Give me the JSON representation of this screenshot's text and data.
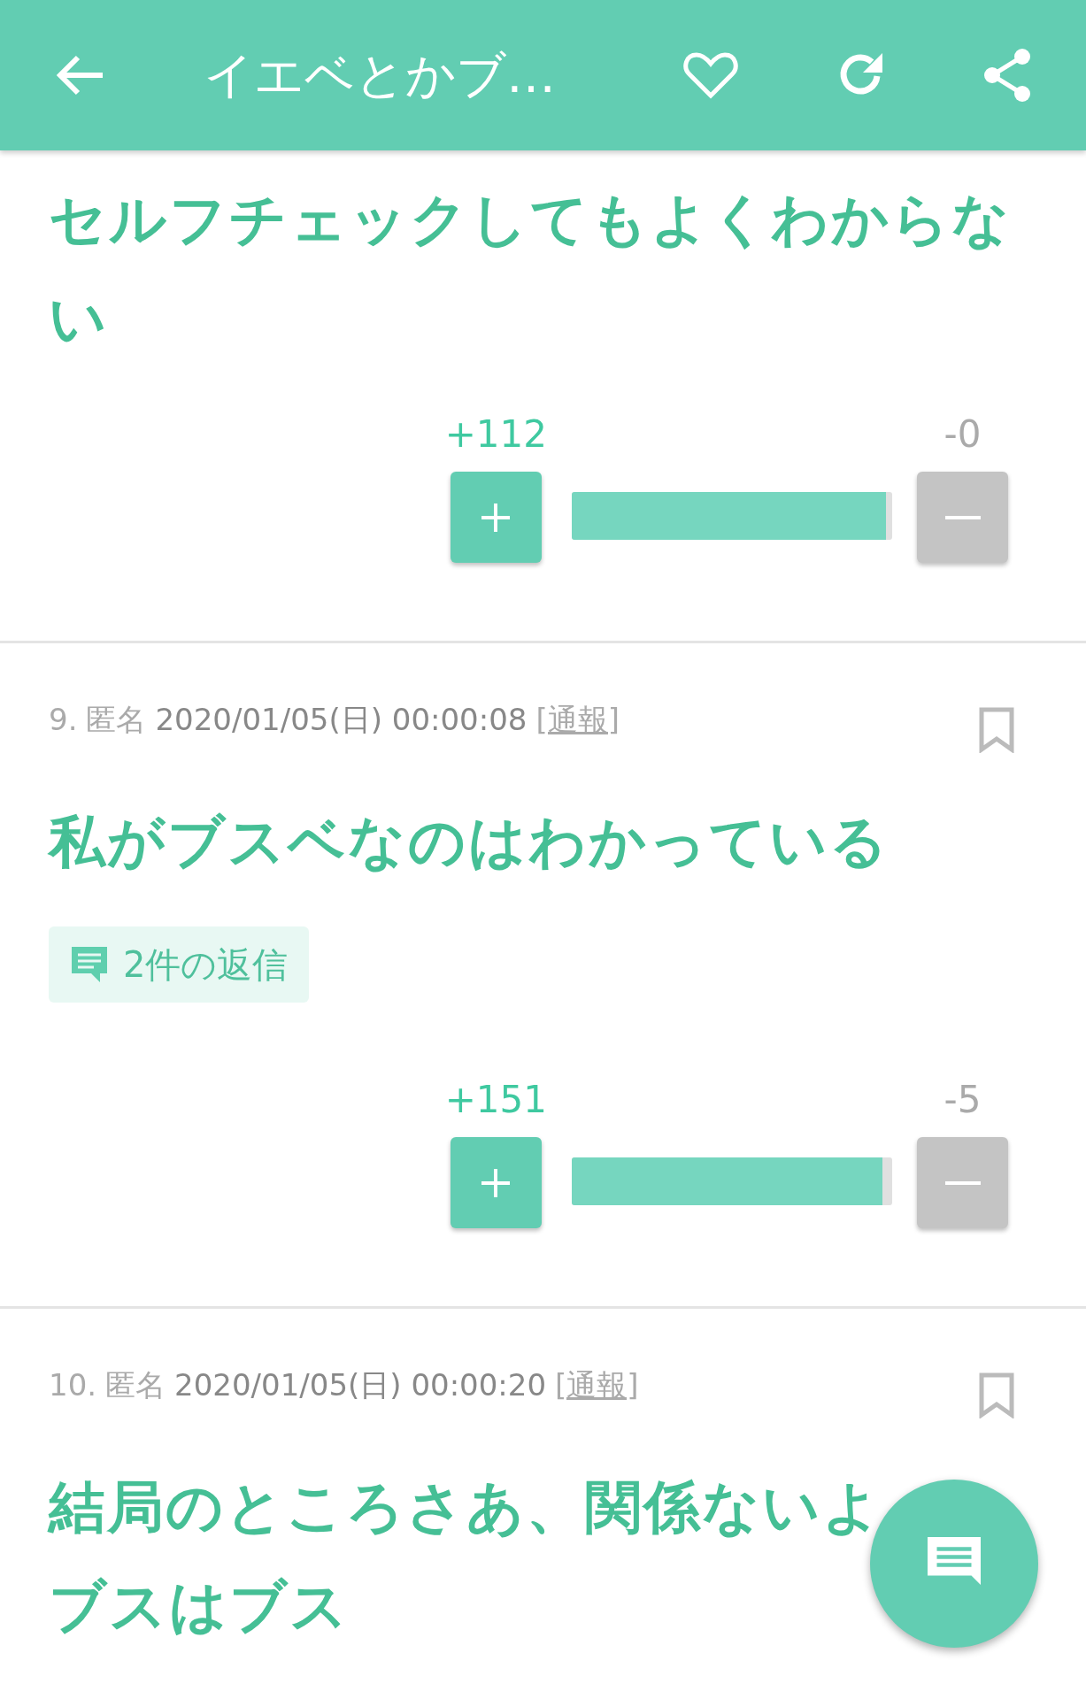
{
  "header": {
    "title": "イエベとかブ…"
  },
  "posts": [
    {
      "body": [
        "セルフチェックしてもよくわからない"
      ],
      "votes": {
        "plus": "+112",
        "minus": "-0",
        "level": 0.98
      }
    },
    {
      "meta": {
        "number": "9.",
        "author": "匿名",
        "date": "2020/01/05(日) 00:00:08",
        "report": "[通報]"
      },
      "body": [
        "私がブスベなのはわかっている"
      ],
      "replies": "2件の返信",
      "votes": {
        "plus": "+151",
        "minus": "-5",
        "level": 0.97
      }
    },
    {
      "meta": {
        "number": "10.",
        "author": "匿名",
        "date": "2020/01/05(日) 00:00:20",
        "report": "[通報]"
      },
      "body": [
        "結局のところさあ、関係ないよ",
        "ブスはブス"
      ]
    }
  ]
}
